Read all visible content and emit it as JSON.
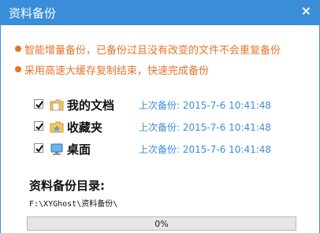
{
  "window": {
    "title": "资料备份",
    "close_label": "×"
  },
  "notes": [
    "智能增量备份，已备份过且没有改变的文件不会重复备份",
    "采用高速大缓存复制结束，快速完成备份"
  ],
  "items": [
    {
      "name": "我的文档",
      "checked": true,
      "icon": "documents-folder-icon",
      "time": "上次备份: 2015-7-6 10:41:48"
    },
    {
      "name": "收藏夹",
      "checked": true,
      "icon": "favorites-folder-icon",
      "time": "上次备份: 2015-7-6 10:41:48"
    },
    {
      "name": "桌面",
      "checked": true,
      "icon": "desktop-icon",
      "time": "上次备份: 2015-7-6 10:41:48"
    }
  ],
  "backup_dir": {
    "label": "资料备份目录:",
    "path": "F:\\XYGhost\\资料备份\\"
  },
  "progress": {
    "value": 0,
    "text": "0%"
  },
  "colors": {
    "accent": "#3a8ed8",
    "note": "#e8732a"
  }
}
